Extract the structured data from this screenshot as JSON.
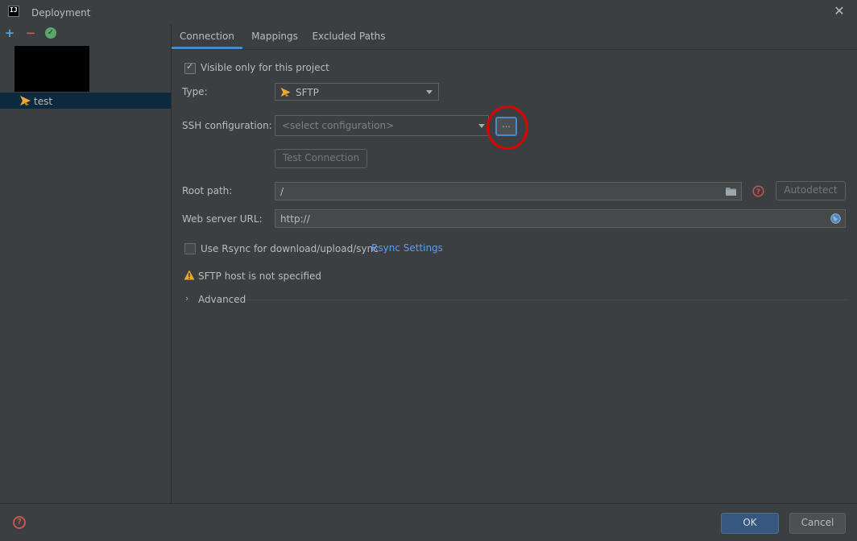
{
  "window": {
    "title": "Deployment",
    "close_glyph": "✕",
    "app_icon_text": "IJ"
  },
  "left_toolbar": {
    "add_glyph": "+",
    "remove_glyph": "−",
    "default_glyph": "✓"
  },
  "servers": [
    {
      "label": "test",
      "icon": "sftp-icon"
    }
  ],
  "tabs": [
    {
      "label": "Connection",
      "active": true
    },
    {
      "label": "Mappings",
      "active": false
    },
    {
      "label": "Excluded Paths",
      "active": false
    }
  ],
  "form": {
    "visible_only_label": "Visible only for this project",
    "visible_only_checked": true,
    "type_label": "Type:",
    "type_value": "SFTP",
    "ssh_label": "SSH configuration:",
    "ssh_placeholder": "<select configuration>",
    "ssh_browse_label": "...",
    "test_connection_label": "Test Connection",
    "root_path_label": "Root path:",
    "root_path_value": "/",
    "autodetect_label": "Autodetect",
    "web_url_label": "Web server URL:",
    "web_url_value": "http://",
    "rsync_label": "Use Rsync for download/upload/sync",
    "rsync_checked": false,
    "rsync_settings_link": "Rsync Settings",
    "warning_text": "SFTP host is not specified",
    "advanced_label": "Advanced"
  },
  "footer": {
    "help_glyph": "?",
    "ok_label": "OK",
    "cancel_label": "Cancel"
  },
  "colors": {
    "background": "#3c3f41",
    "selection": "#0d293e",
    "accent": "#4a88c7",
    "link": "#589df6",
    "annotation_circle": "#e00000"
  }
}
